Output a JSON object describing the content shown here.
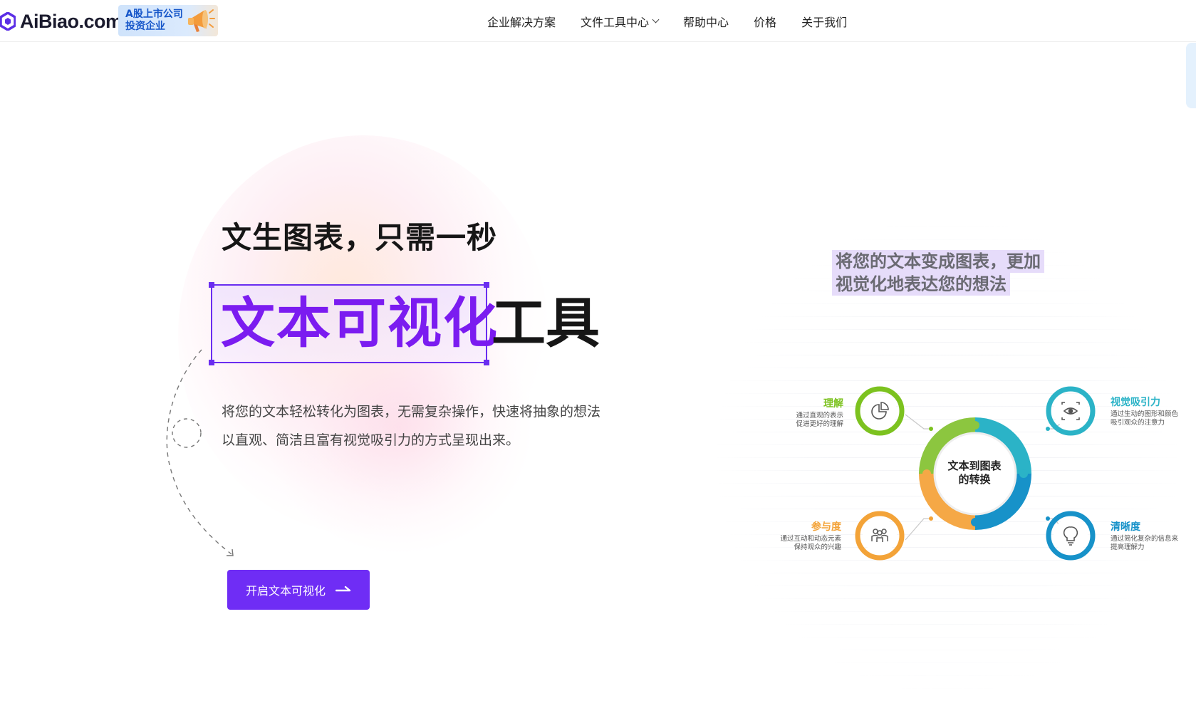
{
  "header": {
    "logo_text": "AiBiao.com",
    "badge_line1": "A股上市公司",
    "badge_line2": "投资企业",
    "nav": [
      {
        "label": "企业解决方案"
      },
      {
        "label": "文件工具中心"
      },
      {
        "label": "帮助中心"
      },
      {
        "label": "价格"
      },
      {
        "label": "关于我们"
      }
    ]
  },
  "hero": {
    "title": "文生图表，只需一秒",
    "highlight": "文本可视化",
    "highlight_rest": "工具",
    "description": "将您的文本轻松转化为图表，无需复杂操作，快速将抽象的想法以直观、简洁且富有视觉吸引力的方式呈现出来。",
    "cta_label": "开启文本可视化"
  },
  "illustration": {
    "tagline_line1": "将您的文本变成图表，更加",
    "tagline_line2": "视觉化地表达您的想法",
    "center_line1": "文本到图表",
    "center_line2": "的转换",
    "features": [
      {
        "title": "理解",
        "desc1": "通过直观的表示",
        "desc2": "促进更好的理解",
        "color": "#7cc21f",
        "icon": "pie-chart-icon"
      },
      {
        "title": "视觉吸引力",
        "desc1": "通过生动的图形和颜色",
        "desc2": "吸引观众的注意力",
        "color": "#2bb3c7",
        "icon": "eye-scan-icon"
      },
      {
        "title": "参与度",
        "desc1": "通过互动和动态元素",
        "desc2": "保持观众的兴趣",
        "color": "#f3a338",
        "icon": "people-icon"
      },
      {
        "title": "清晰度",
        "desc1": "通过简化复杂的信息来",
        "desc2": "提高理解力",
        "color": "#1792c9",
        "icon": "lightbulb-icon"
      }
    ]
  },
  "colors": {
    "brand": "#6f2df5",
    "highlight_text": "#7b1cf0"
  }
}
